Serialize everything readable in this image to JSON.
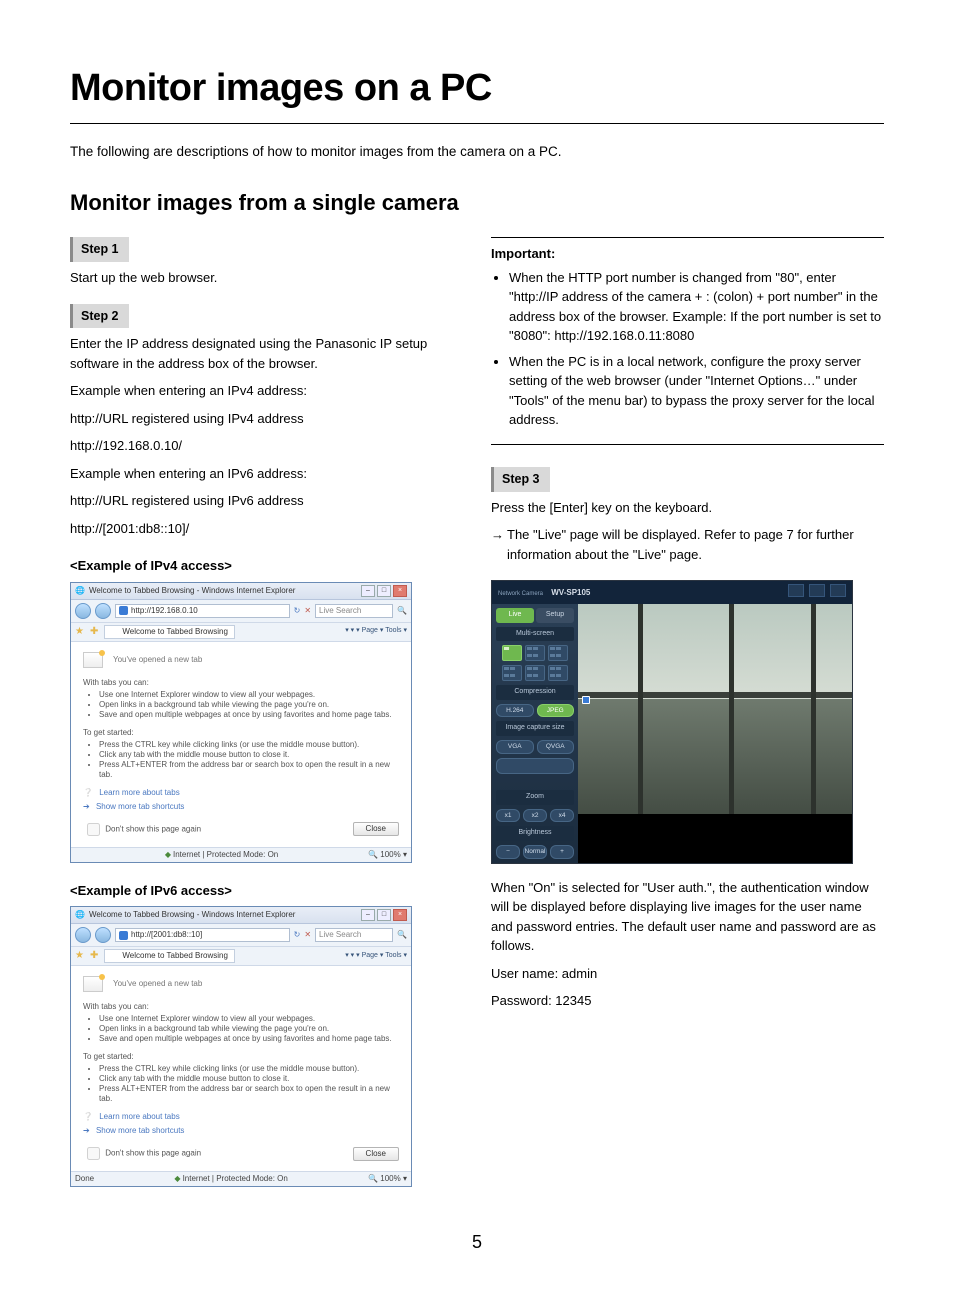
{
  "page_title": "Monitor images on a PC",
  "intro": "The following are descriptions of how to monitor images from the camera on a PC.",
  "section_title": "Monitor images from a single camera",
  "left": {
    "step1_label": "Step 1",
    "step1_text": "Start up the web browser.",
    "step2_label": "Step 2",
    "step2_text": "Enter the IP address designated using the Panasonic IP setup software in the address box of the browser.",
    "ipv4_intro": "Example when entering an IPv4 address:",
    "ipv4_line1": "http://URL registered using IPv4 address",
    "ipv4_line2": "http://192.168.0.10/",
    "ipv6_intro": "Example when entering an IPv6 address:",
    "ipv6_line1": "http://URL registered using IPv6 address",
    "ipv6_line2": "http://[2001:db8::10]/",
    "example_ipv4_head": "<Example of IPv4 access>",
    "example_ipv6_head": "<Example of IPv6 access>",
    "ie_common": {
      "title": "Welcome to Tabbed Browsing - Windows Internet Explorer",
      "tab_label": "Welcome to Tabbed Browsing",
      "search_placeholder": "Live Search",
      "tools_text": "▾  ▾  ▾ Page ▾  Tools ▾",
      "newtab_heading": "You've opened a new tab",
      "with_tabs": "With tabs you can:",
      "with_tabs_items": [
        "Use one Internet Explorer window to view all your webpages.",
        "Open links in a background tab while viewing the page you're on.",
        "Save and open multiple webpages at once by using favorites and home page tabs."
      ],
      "get_started": "To get started:",
      "get_started_items": [
        "Press the CTRL key while clicking links (or use the middle mouse button).",
        "Click any tab with the middle mouse button to close it.",
        "Press ALT+ENTER from the address bar or search box to open the result in a new tab."
      ],
      "learn_more": "Learn more about tabs",
      "show_more": "Show more tab shortcuts",
      "dont_show": "Don't show this page again",
      "close_btn": "Close",
      "status_mid": "Internet | Protected Mode: On",
      "zoom": "100%"
    },
    "ie_ipv4_url": "http://192.168.0.10",
    "ie_ipv4_status_left": "",
    "ie_ipv6_url": "http://[2001:db8::10]",
    "ie_ipv6_status_left": "Done"
  },
  "right": {
    "important_label": "Important:",
    "important_items": [
      "When the HTTP port number is changed from \"80\", enter \"http://IP address of the camera + : (colon) + port number\" in the address box of the browser. Example: If the port number is set to \"8080\": http://192.168.0.11:8080",
      "When the PC is in a local network, configure the proxy server setting of the web browser (under \"Internet Options…\" under \"Tools\" of the menu bar) to bypass the proxy server for the local address."
    ],
    "step3_label": "Step 3",
    "step3_text": "Press the [Enter] key on the keyboard.",
    "step3_arrow": "→",
    "step3_result": "The \"Live\" page will be displayed. Refer to page 7 for further information about the \"Live\" page.",
    "cam": {
      "brand": "Network Camera",
      "model": "WV-SP105",
      "tab_live": "Live",
      "tab_setup": "Setup",
      "multiscreen": "Multi-screen",
      "compression": "Compression",
      "comp_h264": "H.264",
      "comp_jpeg": "JPEG",
      "imgcap": "Image capture size",
      "imgcap_vga": "VGA",
      "imgcap_qvga": "QVGA",
      "zoom": "Zoom",
      "z1": "x1",
      "z2": "x2",
      "z4": "x4",
      "brightness": "Brightness",
      "b_minus": "−",
      "b_normal": "Normal",
      "b_plus": "+"
    },
    "auth_para": "When \"On\" is selected for \"User auth.\", the authentication window will be displayed before displaying live images for the user name and password entries. The default user name and password are as follows.",
    "user_line": "User name: admin",
    "pass_line": "Password: 12345"
  },
  "page_number": "5"
}
